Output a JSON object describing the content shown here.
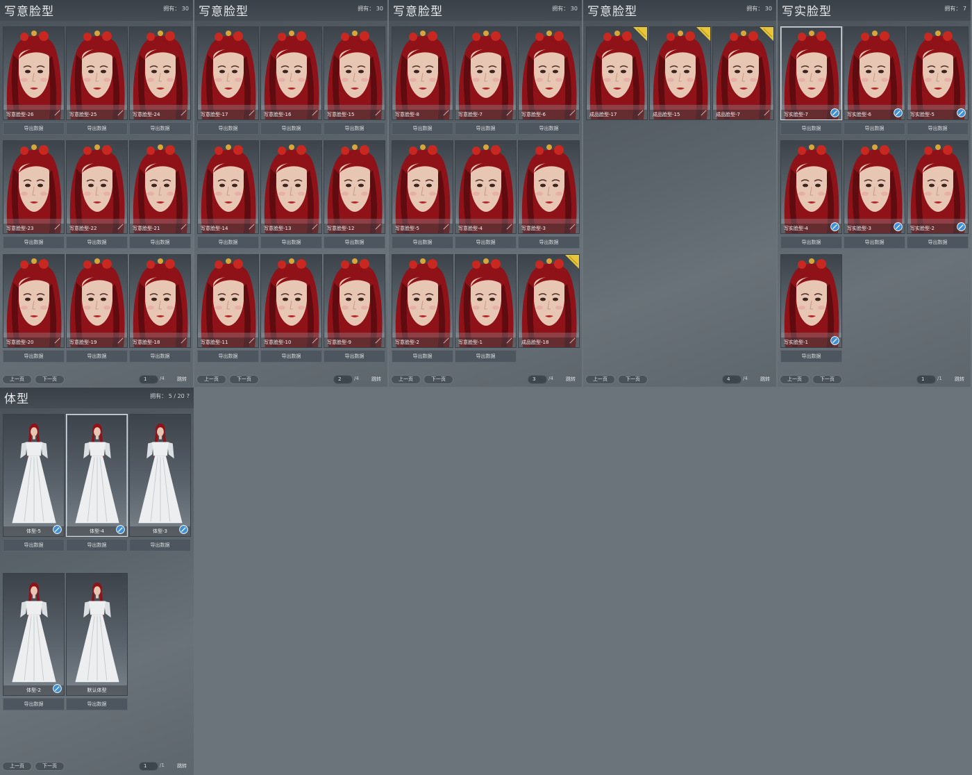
{
  "common": {
    "export_label": "导出数据",
    "prev_label": "上一页",
    "next_label": "下一页",
    "jump_label": "跳转"
  },
  "face_panels": [
    {
      "title": "写意脸型",
      "owned": "拥有： 30",
      "page": "1",
      "total": "/4",
      "tiles": [
        {
          "label": "写意脸型-26",
          "edit": false
        },
        {
          "label": "写意脸型-25",
          "edit": false
        },
        {
          "label": "写意脸型-24",
          "edit": false
        },
        {
          "label": "写意脸型-23",
          "edit": false
        },
        {
          "label": "写意脸型-22",
          "edit": false
        },
        {
          "label": "写意脸型-21",
          "edit": false
        },
        {
          "label": "写意脸型-20",
          "edit": false
        },
        {
          "label": "写意脸型-19",
          "edit": false
        },
        {
          "label": "写意脸型-18",
          "edit": false
        }
      ]
    },
    {
      "title": "写意脸型",
      "owned": "拥有： 30",
      "page": "2",
      "total": "/4",
      "tiles": [
        {
          "label": "写意脸型-17",
          "edit": false
        },
        {
          "label": "写意脸型-16",
          "edit": false
        },
        {
          "label": "写意脸型-15",
          "edit": false
        },
        {
          "label": "写意脸型-14",
          "edit": false
        },
        {
          "label": "写意脸型-13",
          "edit": false
        },
        {
          "label": "写意脸型-12",
          "edit": false
        },
        {
          "label": "写意脸型-11",
          "edit": false
        },
        {
          "label": "写意脸型-10",
          "edit": false
        },
        {
          "label": "写意脸型-9",
          "edit": false
        }
      ]
    },
    {
      "title": "写意脸型",
      "owned": "拥有： 30",
      "page": "3",
      "total": "/4",
      "tiles": [
        {
          "label": "写意脸型-8",
          "edit": false
        },
        {
          "label": "写意脸型-7",
          "edit": false
        },
        {
          "label": "写意脸型-6",
          "edit": false
        },
        {
          "label": "写意脸型-5",
          "edit": false
        },
        {
          "label": "写意脸型-4",
          "edit": false
        },
        {
          "label": "写意脸型-3",
          "edit": false
        },
        {
          "label": "写意脸型-2",
          "edit": false
        },
        {
          "label": "写意脸型-1",
          "edit": false
        },
        {
          "label": "成品脸型-18",
          "edit": false,
          "badge": true,
          "no_export": true
        }
      ]
    },
    {
      "title": "写意脸型",
      "owned": "拥有： 30",
      "page": "4",
      "total": "/4",
      "tiles": [
        {
          "label": "成品脸型-17",
          "edit": false,
          "badge": true,
          "no_export": true
        },
        {
          "label": "成品脸型-15",
          "edit": false,
          "badge": true,
          "no_export": true
        },
        {
          "label": "成品脸型-7",
          "edit": false,
          "badge": true,
          "no_export": true
        }
      ]
    },
    {
      "title": "写实脸型",
      "owned": "拥有： 7",
      "page": "1",
      "total": "/1",
      "tiles": [
        {
          "label": "写实脸型-7",
          "edit": true,
          "selected": true
        },
        {
          "label": "写实脸型-6",
          "edit": true
        },
        {
          "label": "写实脸型-5",
          "edit": true
        },
        {
          "label": "写实脸型-4",
          "edit": true
        },
        {
          "label": "写实脸型-3",
          "edit": true
        },
        {
          "label": "写实脸型-2",
          "edit": true
        },
        {
          "label": "写实脸型-1",
          "edit": true
        }
      ]
    }
  ],
  "body_panel": {
    "title": "体型",
    "owned": "拥有： 5 / 20",
    "help": "?",
    "page": "1",
    "total": "/1",
    "tiles": [
      {
        "label": "体型-5",
        "edit": true
      },
      {
        "label": "体型-4",
        "edit": true,
        "selected": true
      },
      {
        "label": "体型-3",
        "edit": true
      },
      {
        "label": "体型-2",
        "edit": true
      },
      {
        "label": "默认体型",
        "edit": false
      }
    ]
  },
  "colors": {
    "hair": "#8e1218",
    "hair_dark": "#4a0a0d",
    "skin": "#e8c6b4",
    "dress": "#eceef0",
    "badge": "#e7c63a",
    "background": "#6b737b"
  }
}
